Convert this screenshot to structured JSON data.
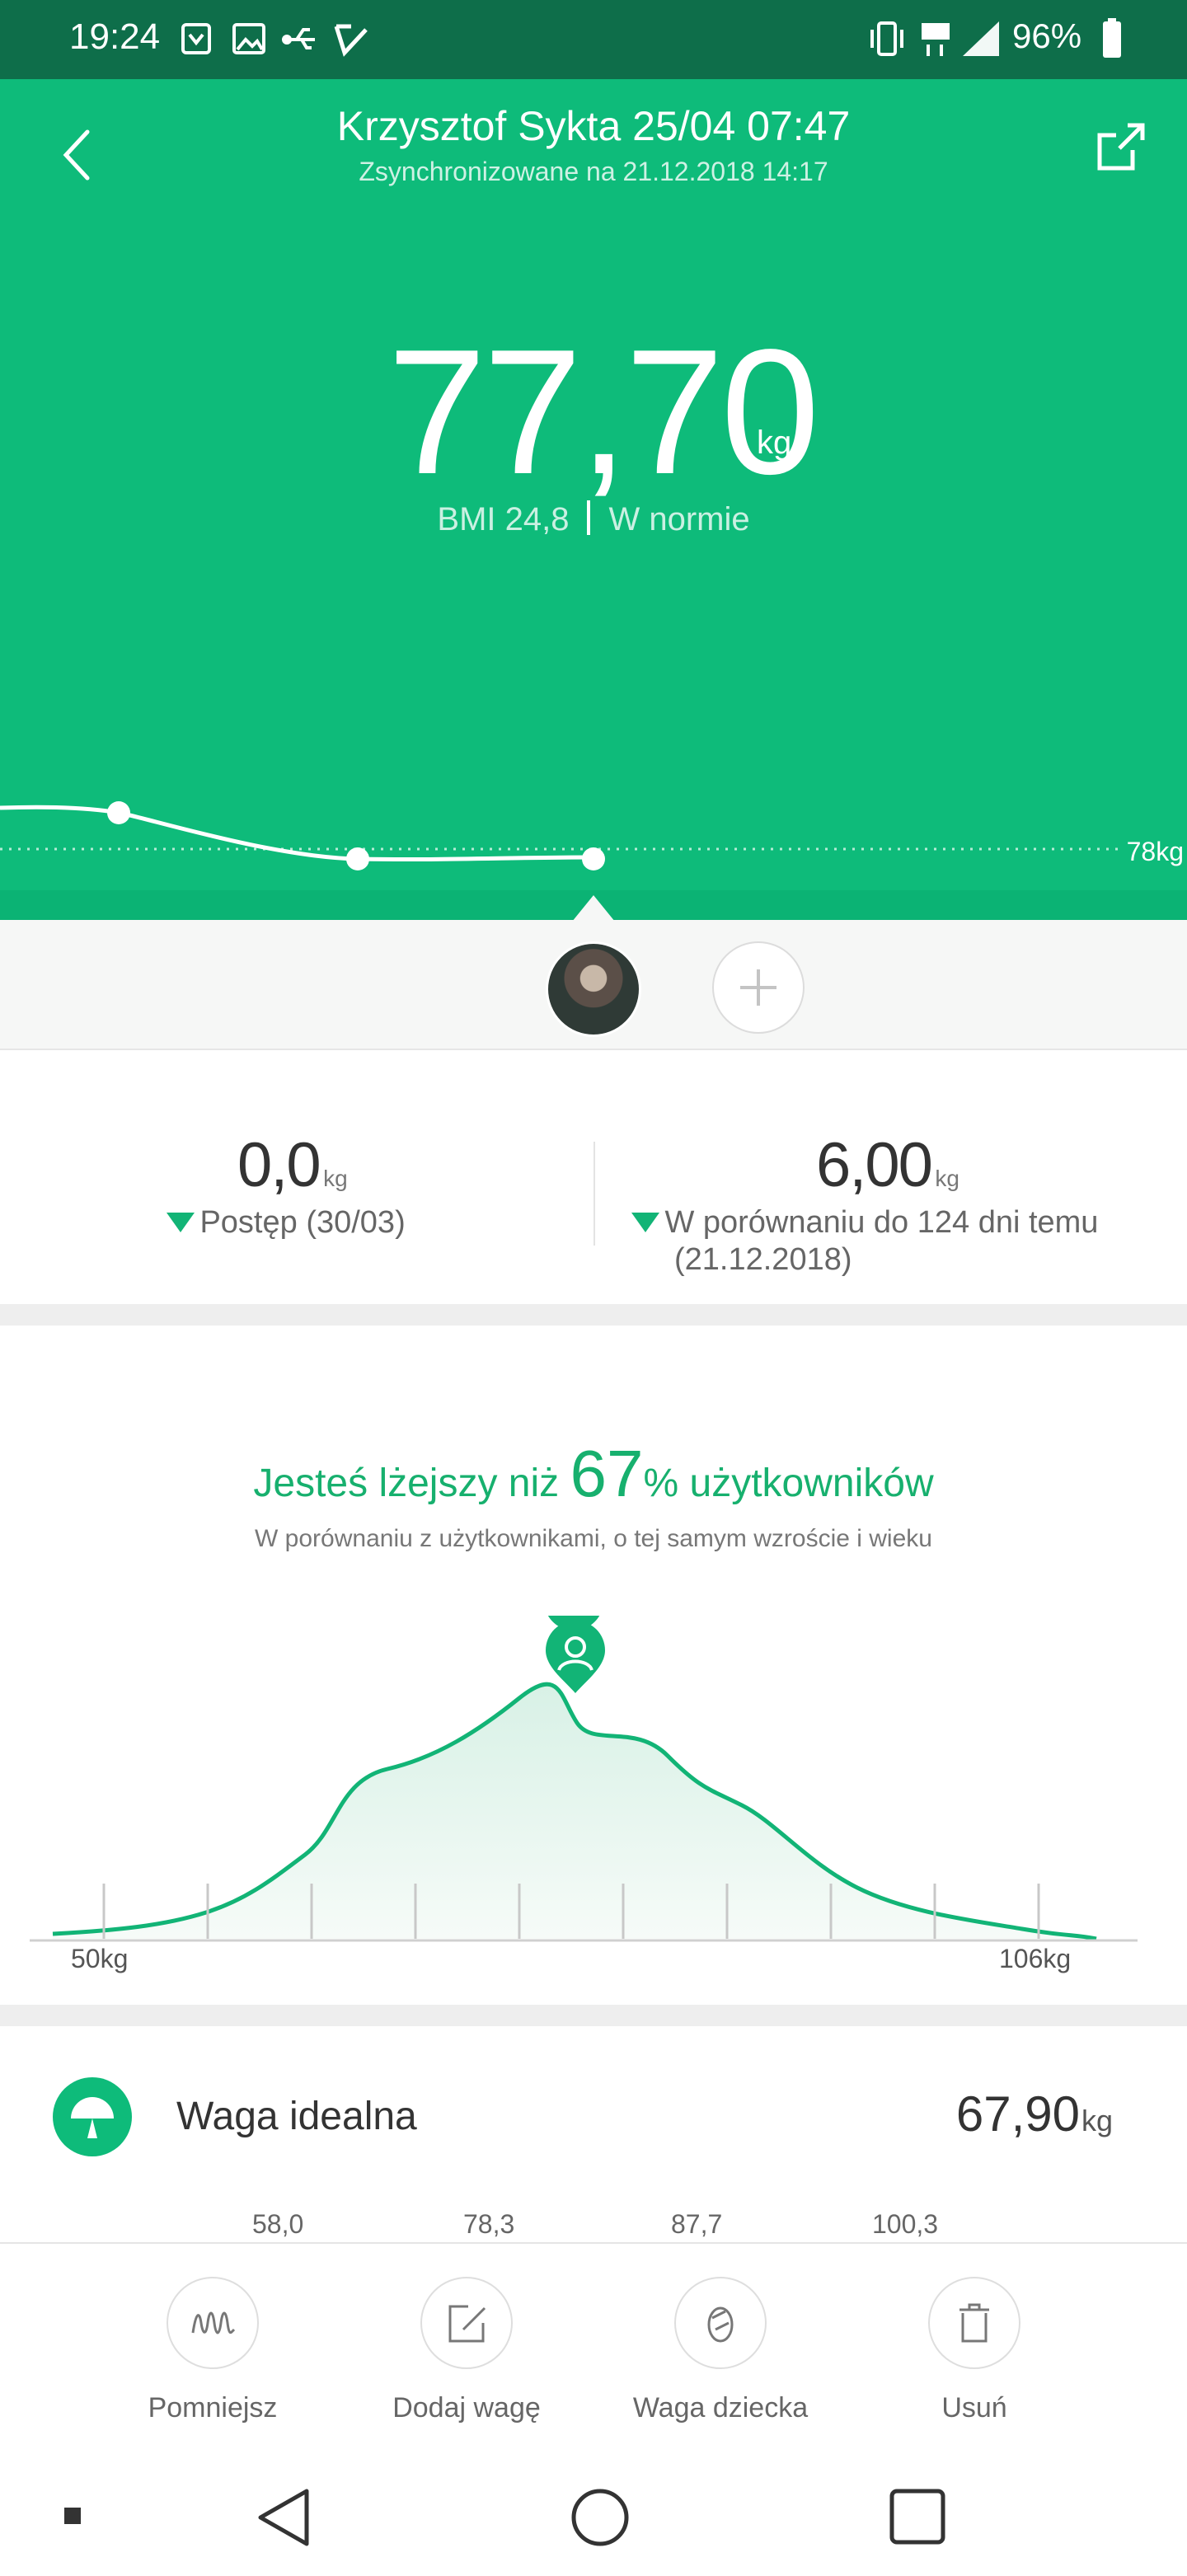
{
  "status_bar": {
    "time": "19:24",
    "battery_pct": "96%",
    "left_icons": [
      "shield-icon",
      "image-icon",
      "usb-icon",
      "check-icon"
    ],
    "right_icons": [
      "vibrate-icon",
      "lte-icon",
      "signal-icon",
      "battery-icon"
    ]
  },
  "header": {
    "title": "Krzysztof Sykta 25/04 07:47",
    "subtitle": "Zsynchronizowane na 21.12.2018 14:17",
    "weight": "77,70",
    "unit": "kg",
    "bmi": "BMI 24,8",
    "bmi_status": "W normie",
    "trend_reference": "78kg"
  },
  "stats": {
    "progress_value": "0,0",
    "progress_unit": "kg",
    "progress_label": "Postęp (30/03)",
    "compare_value": "6,00",
    "compare_unit": "kg",
    "compare_label_line1": "W porównaniu do 124 dni temu",
    "compare_label_line2": "(21.12.2018)"
  },
  "comparison": {
    "title_prefix": "Jesteś lżejszy niż ",
    "percent": "67",
    "title_suffix": "% użytkowników",
    "subtitle": "W porównaniu z użytkownikami, o tej samym wzroście i wieku",
    "min_label": "50kg",
    "max_label": "106kg"
  },
  "ideal": {
    "label": "Waga idealna",
    "value": "67,90",
    "unit": "kg",
    "scale": [
      "58,0",
      "78,3",
      "87,7",
      "100,3"
    ]
  },
  "toolbar": {
    "items": [
      {
        "label": "Pomniejsz",
        "icon": "wave-icon"
      },
      {
        "label": "Dodaj wagę",
        "icon": "edit-icon"
      },
      {
        "label": "Waga dziecka",
        "icon": "baby-icon"
      },
      {
        "label": "Usuń",
        "icon": "trash-icon"
      }
    ]
  },
  "colors": {
    "accent": "#0ebb7a",
    "status_bar": "#0e6e4a"
  }
}
